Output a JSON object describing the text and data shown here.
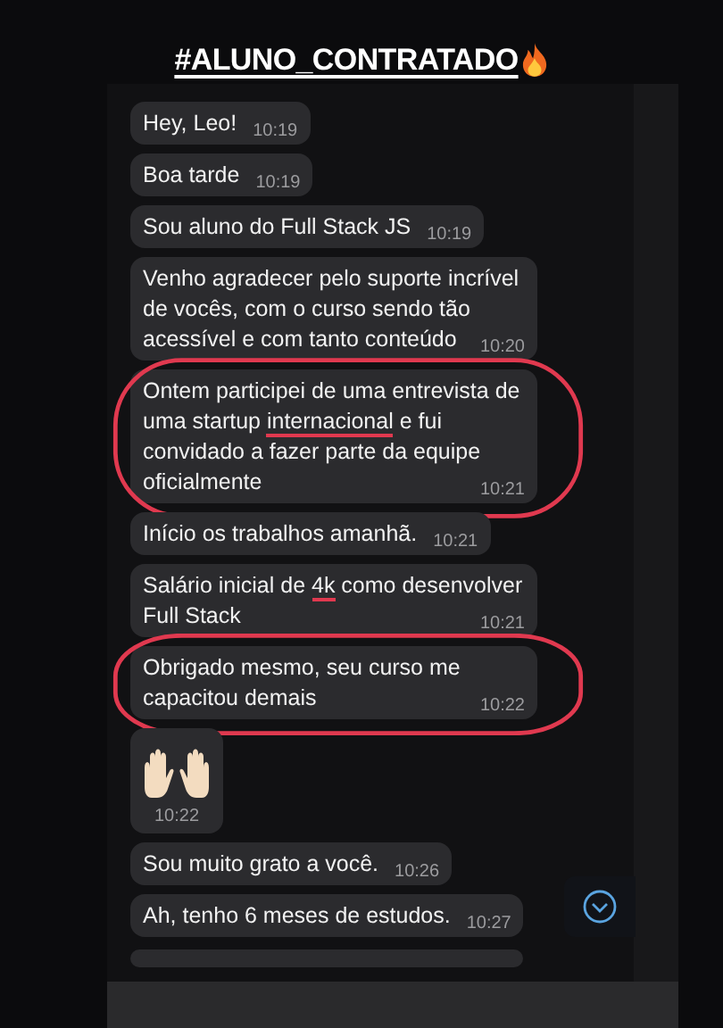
{
  "title": {
    "text": "#ALUNO_CONTRATADO"
  },
  "messages": [
    {
      "kind": "text",
      "segments": [
        {
          "text": "Hey, Leo!",
          "underlined": false
        }
      ],
      "time": "10:19",
      "circled": false
    },
    {
      "kind": "text",
      "segments": [
        {
          "text": "Boa tarde",
          "underlined": false
        }
      ],
      "time": "10:19",
      "circled": false
    },
    {
      "kind": "text",
      "segments": [
        {
          "text": "Sou aluno do Full Stack JS",
          "underlined": false
        }
      ],
      "time": "10:19",
      "circled": false
    },
    {
      "kind": "text",
      "segments": [
        {
          "text": "Venho agradecer pelo suporte incrível de vocês, com o curso sendo tão acessível e com tanto conteúdo",
          "underlined": false
        }
      ],
      "time": "10:20",
      "circled": false
    },
    {
      "kind": "text",
      "segments": [
        {
          "text": "Ontem participei de uma entrevista de uma startup ",
          "underlined": false
        },
        {
          "text": "internacional",
          "underlined": true
        },
        {
          "text": " e fui convidado a fazer parte da equipe oficialmente",
          "underlined": false
        }
      ],
      "time": "10:21",
      "circled": true
    },
    {
      "kind": "text",
      "segments": [
        {
          "text": "Início os trabalhos amanhã.",
          "underlined": false
        }
      ],
      "time": "10:21",
      "circled": false
    },
    {
      "kind": "text",
      "segments": [
        {
          "text": "Salário inicial de ",
          "underlined": false
        },
        {
          "text": "4k",
          "underlined": true
        },
        {
          "text": " como desenvolver Full Stack",
          "underlined": false
        }
      ],
      "time": "10:21",
      "circled": false
    },
    {
      "kind": "text",
      "segments": [
        {
          "text": "Obrigado mesmo, seu curso me capacitou demais",
          "underlined": false
        }
      ],
      "time": "10:22",
      "circled": true
    },
    {
      "kind": "emoji",
      "time": "10:22",
      "circled": false
    },
    {
      "kind": "text",
      "segments": [
        {
          "text": "Sou muito grato a você.",
          "underlined": false
        }
      ],
      "time": "10:26",
      "circled": false
    },
    {
      "kind": "text",
      "segments": [
        {
          "text": "Ah, tenho 6 meses de estudos.",
          "underlined": false
        }
      ],
      "time": "10:27",
      "circled": false
    }
  ]
}
